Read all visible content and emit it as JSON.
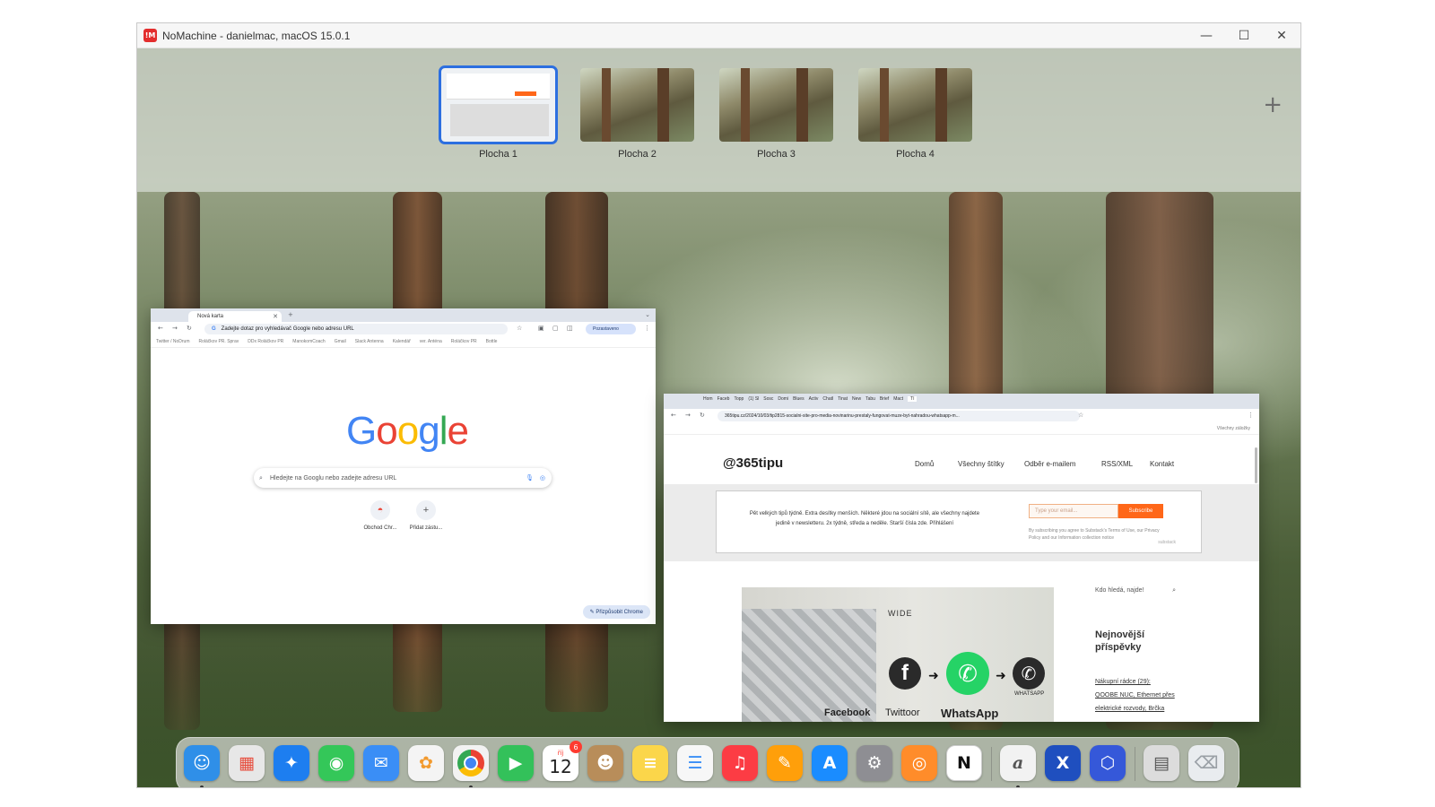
{
  "window": {
    "title": "NoMachine - danielmac, macOS 15.0.1",
    "logo_text": "!M",
    "minimize_icon": "minimize-icon",
    "maximize_icon": "maximize-icon",
    "close_icon": "close-icon"
  },
  "spaces": {
    "items": [
      {
        "label": "Plocha 1",
        "selected": true
      },
      {
        "label": "Plocha 2",
        "selected": false
      },
      {
        "label": "Plocha 3",
        "selected": false
      },
      {
        "label": "Plocha 4",
        "selected": false
      }
    ],
    "add_icon": "+"
  },
  "chrome_left": {
    "tab_title": "Nová karta",
    "omnibox_text": "Zadejte dotaz pro vyhledávač Google nebo adresu URL",
    "profile_label": "Pozastaveno",
    "bookmarks": [
      "Twitter / NoDrum",
      "Roláčkov PR. Sprav",
      "DDx Roláčkov PR",
      "ManokomCoach",
      "Gmail",
      "Slack Antenna",
      "Kalendář",
      "ver. Anténa",
      "Roláčkov PR",
      "Bottle"
    ],
    "google_letters": [
      "G",
      "o",
      "o",
      "g",
      "l",
      "e"
    ],
    "search_placeholder": "Hledejte na Googlu nebo zadejte adresu URL",
    "shortcuts": [
      "Obchod Chr...",
      "Přidat zástu..."
    ],
    "customize_label": "Přizpůsobit Chrome"
  },
  "chrome_right": {
    "tabs": [
      "Hom",
      "Faceb",
      "Topp",
      "(1) Sl",
      "Sosc",
      "Domi",
      "Blues",
      "Activ",
      "Chatl",
      "Tinat",
      "New",
      "Tabu",
      "Brief",
      "Mact",
      "Tì"
    ],
    "url": "365tipu.cz/2024/10/03/tip2815-socialni-site-pro-media-novinarinu-prestaly-fungovat-muze-byt-nahradou-whatsapp-m...",
    "bookmarks_end": "Všechny záložky",
    "site": {
      "brand": "@365tipu",
      "nav": [
        "Domů",
        "Všechny štítky",
        "Odběr e-mailem",
        "RSS/XML",
        "Kontakt"
      ],
      "newsletter_text": "Pět velkých tipů týdně. Extra desítky menších. Některé jdou na sociální sítě, ale všechny najdete jedině v newsletteru. 2x týdně, středa a neděle. Starší čísla zde. Přihlášení",
      "email_placeholder": "Type your email...",
      "subscribe_label": "Subscribe",
      "terms_text": "By subscribing you agree to Substack's Terms of Use, our Privacy Policy and our Information collection notice",
      "substack_label": "substack",
      "image_caption_wide": "WIDE",
      "image_labels": [
        "Facebook",
        "Twittoor",
        "WhatsApp",
        "WHATSAPP"
      ],
      "search_placeholder": "Kdo hledá, najde!",
      "sidebar_heading": "Nejnovější příspěvky",
      "sidebar_links": [
        "Nákupní rádce (29):",
        "QOOBE NUC, Ethernet přes",
        "elektrické rozvody, Brčka"
      ]
    }
  },
  "dock": {
    "calendar_month": "říj",
    "calendar_day": "12",
    "calendar_badge": "6",
    "apps": [
      {
        "name": "Finder",
        "icon": "finder-icon",
        "color": "#2f8fe8",
        "glyph": "☺",
        "running": true
      },
      {
        "name": "Launchpad",
        "icon": "launchpad-icon",
        "color": "#e7e7e7",
        "glyph": "▦",
        "running": false
      },
      {
        "name": "Safari",
        "icon": "safari-icon",
        "color": "#1d7ef0",
        "glyph": "✦",
        "running": false
      },
      {
        "name": "Messages",
        "icon": "messages-icon",
        "color": "#34c759",
        "glyph": "◉",
        "running": false
      },
      {
        "name": "Mail",
        "icon": "mail-icon",
        "color": "#3a8ef6",
        "glyph": "✉",
        "running": false
      },
      {
        "name": "Photos",
        "icon": "photos-icon",
        "color": "#f4f4f4",
        "glyph": "✿",
        "running": false
      },
      {
        "name": "Chrome",
        "icon": "chrome-icon",
        "color": "#f2f2f2",
        "glyph": "●",
        "running": true
      },
      {
        "name": "FaceTime",
        "icon": "facetime-icon",
        "color": "#33c15a",
        "glyph": "▶",
        "running": false
      },
      {
        "name": "Calendar",
        "icon": "calendar-icon",
        "color": "#ffffff",
        "glyph": "",
        "running": false
      },
      {
        "name": "Contacts",
        "icon": "contacts-icon",
        "color": "#b88d5a",
        "glyph": "☻",
        "running": false
      },
      {
        "name": "Notes",
        "icon": "notes-icon",
        "color": "#fbd64a",
        "glyph": "≡",
        "running": false
      },
      {
        "name": "Reminders",
        "icon": "reminders-icon",
        "color": "#f7f7f7",
        "glyph": "☰",
        "running": false
      },
      {
        "name": "Music",
        "icon": "music-icon",
        "color": "#fc3c44",
        "glyph": "♫",
        "running": false
      },
      {
        "name": "Pages",
        "icon": "pages-icon",
        "color": "#ff9f0a",
        "glyph": "✎",
        "running": false
      },
      {
        "name": "App Store",
        "icon": "app-store-icon",
        "color": "#1a8cff",
        "glyph": "A",
        "running": false
      },
      {
        "name": "System Settings",
        "icon": "system-settings-icon",
        "color": "#8e8e93",
        "glyph": "⚙",
        "running": false
      },
      {
        "name": "NoMachine Monitor",
        "icon": "nomachine-monitor-icon",
        "color": "#ff8c2a",
        "glyph": "◎",
        "running": false
      },
      {
        "name": "Notion",
        "icon": "notion-icon",
        "color": "#ffffff",
        "glyph": "N",
        "running": false
      },
      {
        "name": "Script Editor",
        "icon": "script-editor-icon",
        "color": "#f2f2f2",
        "glyph": "a",
        "running": true
      },
      {
        "name": "Xcode",
        "icon": "x-app-icon",
        "color": "#1f4fbf",
        "glyph": "X",
        "running": false
      },
      {
        "name": "VirtualBox",
        "icon": "cube-app-icon",
        "color": "#3558d9",
        "glyph": "⬡",
        "running": false
      },
      {
        "name": "Downloads",
        "icon": "downloads-stack-icon",
        "color": "#dcdcdc",
        "glyph": "▤",
        "running": false
      },
      {
        "name": "Trash",
        "icon": "trash-icon",
        "color": "#e9ecef",
        "glyph": "🗑",
        "running": false
      }
    ]
  }
}
